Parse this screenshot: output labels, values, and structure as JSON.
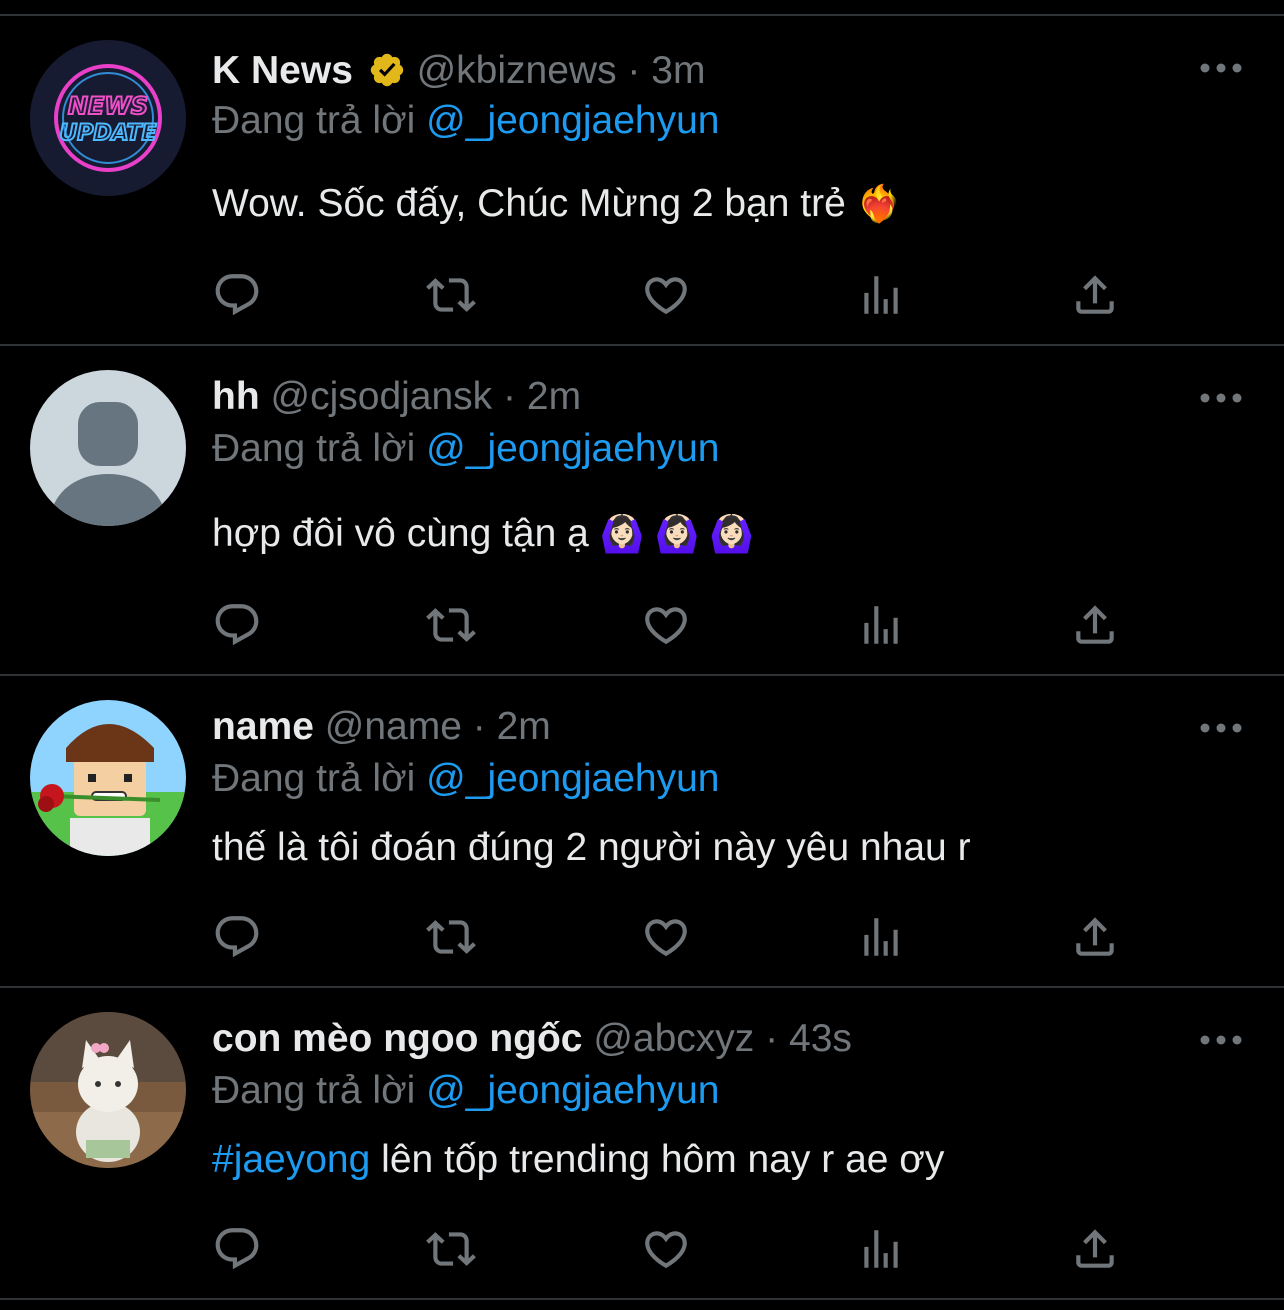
{
  "reply_prefix": "Đang trả lời",
  "tweets": [
    {
      "name": "K News",
      "handle": "@kbiznews",
      "separator": "·",
      "time": "3m",
      "verified": true,
      "reply_to": "@_jeongjaehyun",
      "text": "Wow. Sốc đấy, Chúc Mừng 2 bạn trẻ",
      "emoji": "❤️‍🔥",
      "avatar": "news-update-logo"
    },
    {
      "name": "hh",
      "handle": "@cjsodjansk",
      "separator": "·",
      "time": "2m",
      "reply_to": "@_jeongjaehyun",
      "text": "hợp đôi vô cùng tận ạ",
      "emoji": "🙆🏻‍♀️ 🙆🏻‍♀️ 🙆🏻‍♀️",
      "avatar": "default-profile"
    },
    {
      "name": "name",
      "handle": "@name",
      "separator": "·",
      "time": "2m",
      "reply_to": "@_jeongjaehyun",
      "text": "thế là tôi đoán đúng 2 người này yêu nhau r",
      "avatar": "blocky-character-with-rose"
    },
    {
      "name": "con mèo ngoo ngốc",
      "handle": "@abcxyz",
      "separator": "·",
      "time": "43s",
      "reply_to": "@_jeongjaehyun",
      "hashtag": "#jaeyong",
      "text": " lên tốp trending hôm nay r ae ơy",
      "avatar": "toy-cat-photo"
    }
  ],
  "icons": {
    "reply": "reply-icon",
    "retweet": "retweet-icon",
    "like": "heart-icon",
    "views": "views-icon",
    "share": "share-icon",
    "more": "more-icon"
  },
  "colors": {
    "background": "#000000",
    "text": "#e7e9ea",
    "muted": "#71767b",
    "link": "#1d9bf0",
    "divider": "#2f3336",
    "verified_badge": "#e2b719"
  }
}
